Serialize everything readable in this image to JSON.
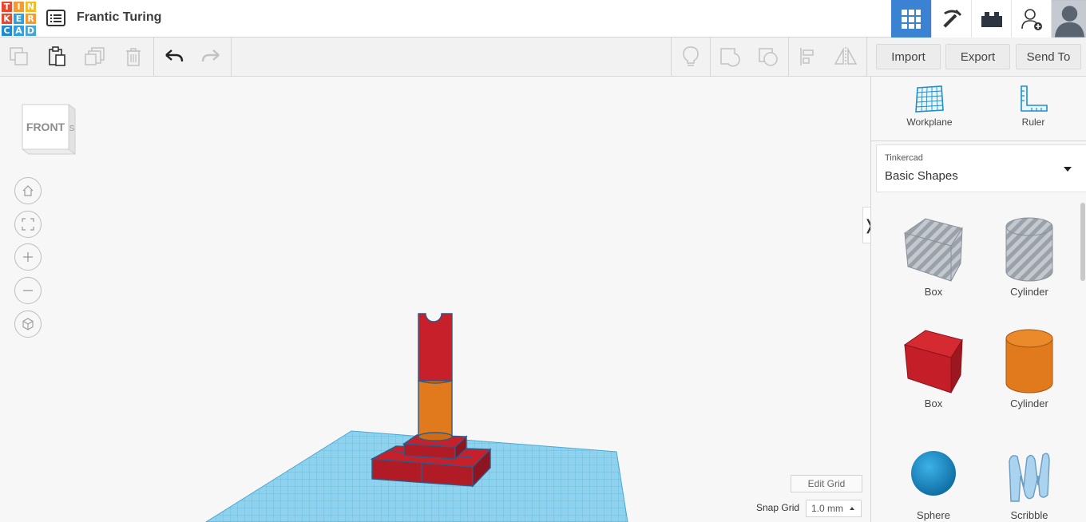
{
  "app": {
    "logo_letters": [
      "T",
      "I",
      "N",
      "K",
      "E",
      "R",
      "C",
      "A",
      "D"
    ],
    "logo_colors": [
      "#e8492e",
      "#f79a2b",
      "#f5bb25",
      "#e8492e",
      "#2aa1e2",
      "#f79a2b",
      "#1f8bd1",
      "#2aa1e2",
      "#46a5d3"
    ],
    "title": "Frantic Turing"
  },
  "header": {
    "buttons": [
      {
        "name": "3d-view",
        "icon": "grid-icon",
        "active": true
      },
      {
        "name": "codeblocks",
        "icon": "pickaxe-icon",
        "active": false
      },
      {
        "name": "bricks",
        "icon": "brick-icon",
        "active": false
      },
      {
        "name": "invite",
        "icon": "add-user-icon",
        "active": false
      },
      {
        "name": "profile",
        "icon": "avatar-icon",
        "active": false
      }
    ],
    "accent": "#3b83d2"
  },
  "toolbar": {
    "tools": [
      "copy-icon",
      "paste-icon",
      "duplicate-icon",
      "delete-icon",
      "undo-icon",
      "redo-icon"
    ],
    "view_tools": [
      "lightbulb-icon",
      "group-icon",
      "ungroup-icon",
      "align-icon",
      "mirror-icon"
    ],
    "import_label": "Import",
    "export_label": "Export",
    "send_label": "Send To"
  },
  "viewport": {
    "viewcube_label": "FRONT",
    "nav_buttons": [
      "home-icon",
      "fit-icon",
      "zoom-in-icon",
      "zoom-out-icon",
      "perspective-icon"
    ],
    "edit_grid_label": "Edit Grid",
    "snap_grid_label": "Snap Grid",
    "snap_grid_value": "1.0 mm",
    "collapse_glyph": "❭"
  },
  "panel": {
    "workplane_label": "Workplane",
    "ruler_label": "Ruler",
    "library_category": "Tinkercad",
    "library_name": "Basic Shapes",
    "shapes": [
      {
        "label": "Box",
        "kind": "box-hole"
      },
      {
        "label": "Cylinder",
        "kind": "cylinder-hole"
      },
      {
        "label": "Box",
        "kind": "box-solid"
      },
      {
        "label": "Cylinder",
        "kind": "cylinder-solid"
      },
      {
        "label": "Sphere",
        "kind": "sphere"
      },
      {
        "label": "Scribble",
        "kind": "scribble"
      }
    ],
    "shape_colors": {
      "red": "#c8202b",
      "orange": "#e07a1c",
      "blue": "#1f8fc9",
      "grey": "#b9bec5"
    }
  }
}
